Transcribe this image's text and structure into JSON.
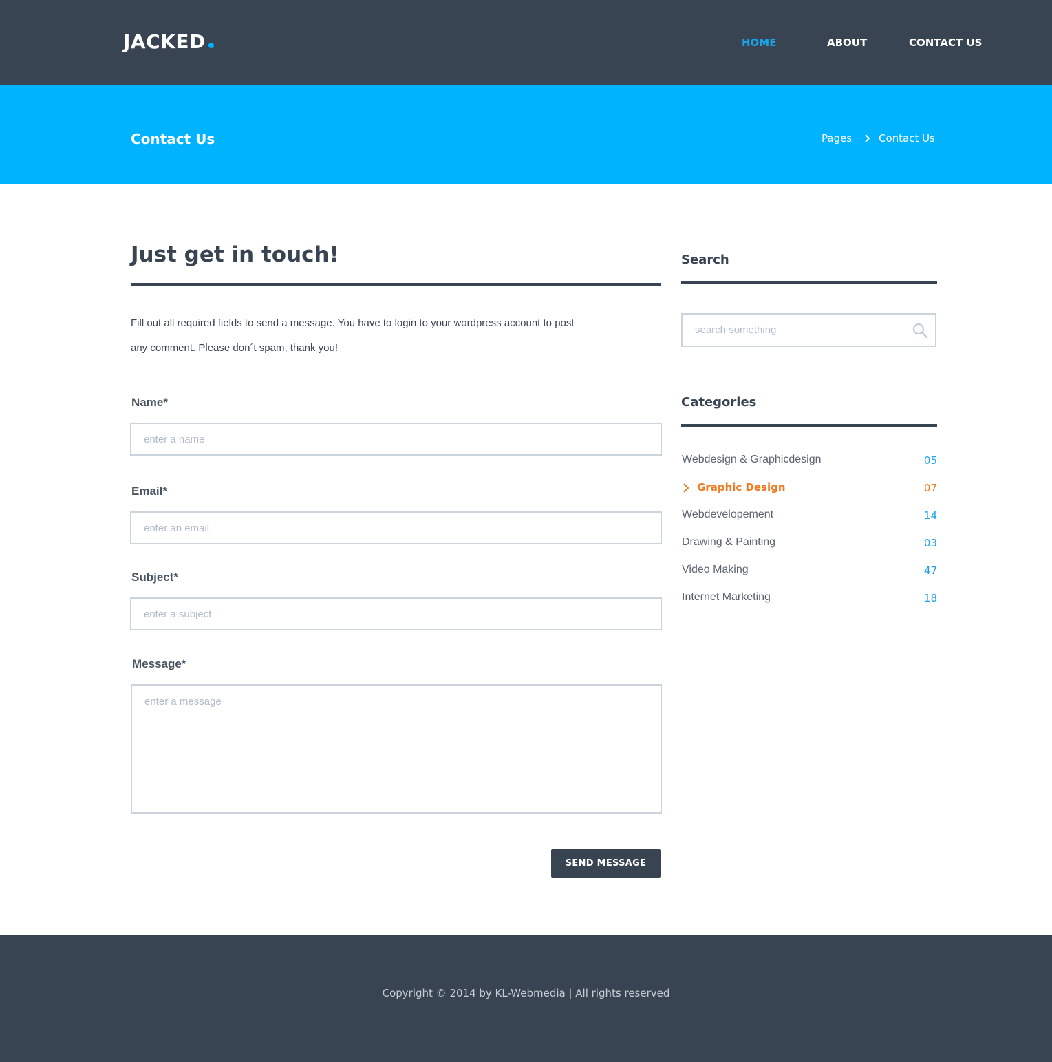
{
  "brand": {
    "logo_text": "JACKED",
    "accent_color": "#00b3ff"
  },
  "nav": {
    "home": "HOME",
    "about": "ABOUT",
    "contact": "CONTACT US"
  },
  "banner": {
    "title": "Contact Us",
    "breadcrumb": {
      "parent": "Pages",
      "current": "Contact Us"
    }
  },
  "main": {
    "heading": "Just get in touch!",
    "intro_line1": "Fill out all required fields to send a message. You have to login to your wordpress account to post",
    "intro_line2": "any comment. Please don´t spam, thank you!",
    "form": {
      "name_label": "Name*",
      "name_placeholder": "enter a name",
      "email_label": "Email*",
      "email_placeholder": "enter an email",
      "subject_label": "Subject*",
      "subject_placeholder": "enter a subject",
      "message_label": "Message*",
      "message_placeholder": "enter a message",
      "submit_label": "SEND MESSAGE"
    }
  },
  "sidebar": {
    "search": {
      "heading": "Search",
      "placeholder": "search something",
      "icon": "search-icon"
    },
    "categories": {
      "heading": "Categories",
      "items": [
        {
          "label": "Webdesign & Graphicdesign",
          "count": "05",
          "active": false
        },
        {
          "label": "Graphic Design",
          "count": "07",
          "active": true
        },
        {
          "label": "Webdevelopement",
          "count": "14",
          "active": false
        },
        {
          "label": "Drawing & Painting",
          "count": "03",
          "active": false
        },
        {
          "label": "Video Making",
          "count": "47",
          "active": false
        },
        {
          "label": "Internet Marketing",
          "count": "18",
          "active": false
        }
      ]
    }
  },
  "footer": {
    "copyright": "Copyright © 2014 by KL-Webmedia | All rights reserved"
  },
  "colors": {
    "dark": "#394452",
    "banner": "#00b3ff",
    "link_active": "#1aa3e8",
    "category_active": "#f07a21"
  }
}
